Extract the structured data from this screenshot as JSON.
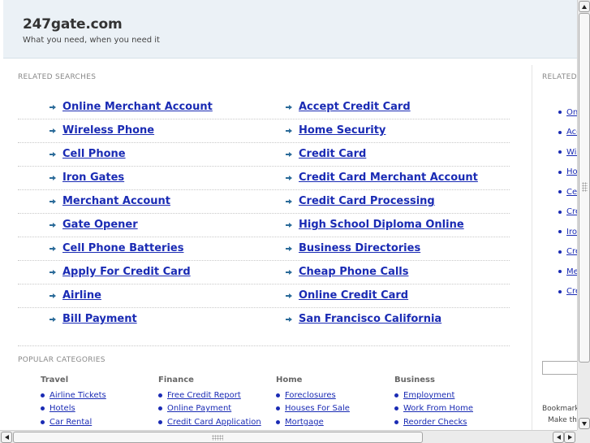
{
  "header": {
    "title": "247gate.com",
    "tagline": "What you need, when you need it"
  },
  "related_searches": {
    "label": "RELATED SEARCHES",
    "rows": [
      [
        "Online Merchant Account",
        "Accept Credit Card"
      ],
      [
        "Wireless Phone",
        "Home Security"
      ],
      [
        "Cell Phone",
        "Credit Card"
      ],
      [
        "Iron Gates",
        "Credit Card Merchant Account"
      ],
      [
        "Merchant Account",
        "Credit Card Processing"
      ],
      [
        "Gate Opener",
        "High School Diploma Online"
      ],
      [
        "Cell Phone Batteries",
        "Business Directories"
      ],
      [
        "Apply For Credit Card",
        "Cheap Phone Calls"
      ],
      [
        "Airline",
        "Online Credit Card"
      ],
      [
        "Bill Payment",
        "San Francisco California"
      ]
    ]
  },
  "popular_categories": {
    "label": "POPULAR CATEGORIES",
    "columns": [
      {
        "heading": "Travel",
        "items": [
          "Airline Tickets",
          "Hotels",
          "Car Rental"
        ]
      },
      {
        "heading": "Finance",
        "items": [
          "Free Credit Report",
          "Online Payment",
          "Credit Card Application"
        ]
      },
      {
        "heading": "Home",
        "items": [
          "Foreclosures",
          "Houses For Sale",
          "Mortgage"
        ]
      },
      {
        "heading": "Business",
        "items": [
          "Employment",
          "Work From Home",
          "Reorder Checks"
        ]
      }
    ]
  },
  "sidebar": {
    "label": "RELATED",
    "items": [
      "Onl",
      "Acc",
      "Wir",
      "Hor",
      "Cel",
      "Cre",
      "Iron",
      "Cre",
      "Mer",
      "Cre"
    ],
    "bookmark_text": "Bookmark",
    "make_this_text": "Make thi"
  },
  "colors": {
    "link": "#1a2bb4",
    "header_bg": "#ebf1f6",
    "arrow": "#2b6b99"
  }
}
